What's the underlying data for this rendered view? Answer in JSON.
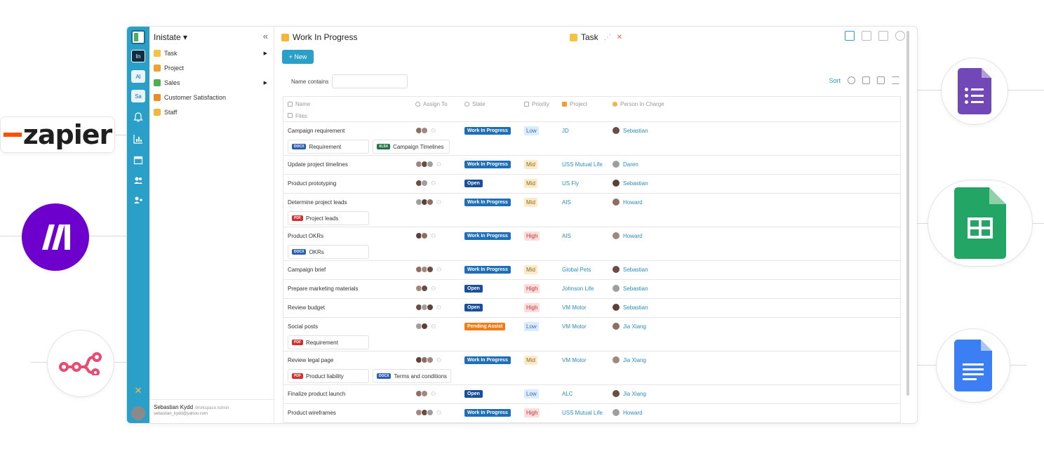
{
  "integrations": {
    "zapier_label": "zapier",
    "items": [
      {
        "name": "zapier-logo"
      },
      {
        "name": "make-logo",
        "color": "#6d00cc"
      },
      {
        "name": "n8n-logo",
        "color": "#ea4b71"
      },
      {
        "name": "google-forms-logo",
        "color": "#7248b9"
      },
      {
        "name": "google-sheets-logo",
        "color": "#23a566"
      },
      {
        "name": "google-docs-logo",
        "color": "#3c7ff5"
      }
    ]
  },
  "rail": {
    "workspaces": [
      "In",
      "Al",
      "Sa"
    ],
    "accent": "#2aa0c8"
  },
  "sidebar": {
    "workspace_title": "Inistate ▾",
    "collapse": "«",
    "items": [
      {
        "label": "Task",
        "icon_color": "#f5c242",
        "arrow": "▶"
      },
      {
        "label": "Project",
        "icon_color": "#f0a030",
        "arrow": ""
      },
      {
        "label": "Sales",
        "icon_color": "#4caf50",
        "arrow": "▶"
      },
      {
        "label": "Customer Satisfaction",
        "icon_color": "#f08a24",
        "arrow": ""
      },
      {
        "label": "Staff",
        "icon_color": "#f5b43c",
        "arrow": ""
      }
    ],
    "user_name": "Sebastian Kydd",
    "user_role": "Workspace Admin",
    "user_email": "sebastian_kydd@yahoo.com"
  },
  "main": {
    "title": "Work In Progress",
    "view_title": "Task",
    "new_button": "+ New",
    "filter_label": "Name contains",
    "filter_placeholder": "",
    "sort_label": "Sort",
    "columns": {
      "name": "Name",
      "assign": "Assign To",
      "state": "State",
      "priority": "Priority",
      "project": "Project",
      "person": "Person In Charge",
      "files": "Files"
    },
    "state_colors": {
      "Work In Progress": "#1f6fb8",
      "Open": "#1a4f9c",
      "Pending Assist": "#f07d16"
    },
    "priority_colors": {
      "Low": {
        "bg": "#dcecff",
        "fg": "#3d6ea8"
      },
      "Mid": {
        "bg": "#fdebc8",
        "fg": "#8a6a2a"
      },
      "High": {
        "bg": "#fddcdc",
        "fg": "#c0393b"
      }
    },
    "rows": [
      {
        "name": "Campaign requirement",
        "state": "Work In Progress",
        "priority": "Low",
        "project": "JD",
        "person": "Sebastian",
        "files": [
          {
            "tag": "DOCX",
            "tag_color": "#2b5fb4",
            "label": "Requirement"
          },
          {
            "tag": "XLSX",
            "tag_color": "#217346",
            "label": "Campaign Timelines"
          }
        ]
      },
      {
        "name": "Update project timelines",
        "state": "Work In Progress",
        "priority": "Mid",
        "project": "USS Mutual Life",
        "person": "Daren",
        "files": []
      },
      {
        "name": "Product prototyping",
        "state": "Open",
        "priority": "Mid",
        "project": "US Fly",
        "person": "Sebastian",
        "files": []
      },
      {
        "name": "Determine project leads",
        "state": "Work In Progress",
        "priority": "Mid",
        "project": "AIS",
        "person": "Howard",
        "files": [
          {
            "tag": "PDF",
            "tag_color": "#d32f2f",
            "label": "Project leads"
          }
        ]
      },
      {
        "name": "Product OKRs",
        "state": "Work In Progress",
        "priority": "High",
        "project": "AIS",
        "person": "Howard",
        "files": [
          {
            "tag": "DOCX",
            "tag_color": "#2b5fb4",
            "label": "OKRs"
          }
        ]
      },
      {
        "name": "Campaign brief",
        "state": "Work In Progress",
        "priority": "Mid",
        "project": "Global Pets",
        "person": "Sebastian",
        "files": []
      },
      {
        "name": "Prepare marketing materials",
        "state": "Open",
        "priority": "High",
        "project": "Johnson Life",
        "person": "Sebastian",
        "files": []
      },
      {
        "name": "Review budget",
        "state": "Open",
        "priority": "High",
        "project": "VM Motor",
        "person": "Sebastian",
        "files": []
      },
      {
        "name": "Social posts",
        "state": "Pending Assist",
        "priority": "Low",
        "project": "VM Motor",
        "person": "Jia Xiang",
        "files": [
          {
            "tag": "PDF",
            "tag_color": "#d32f2f",
            "label": "Requirement"
          }
        ]
      },
      {
        "name": "Review legal page",
        "state": "Work In Progress",
        "priority": "Mid",
        "project": "VM Motor",
        "person": "Jia Xiang",
        "files": [
          {
            "tag": "PDF",
            "tag_color": "#d32f2f",
            "label": "Product liability"
          },
          {
            "tag": "DOCX",
            "tag_color": "#2b5fb4",
            "label": "Terms and conditions"
          }
        ]
      },
      {
        "name": "Finalize product launch",
        "state": "Open",
        "priority": "Low",
        "project": "ALC",
        "person": "Jia Xiang",
        "files": []
      },
      {
        "name": "Product wireframes",
        "state": "Work In Progress",
        "priority": "High",
        "project": "USS Mutual Life",
        "person": "Howard",
        "files": []
      }
    ]
  }
}
